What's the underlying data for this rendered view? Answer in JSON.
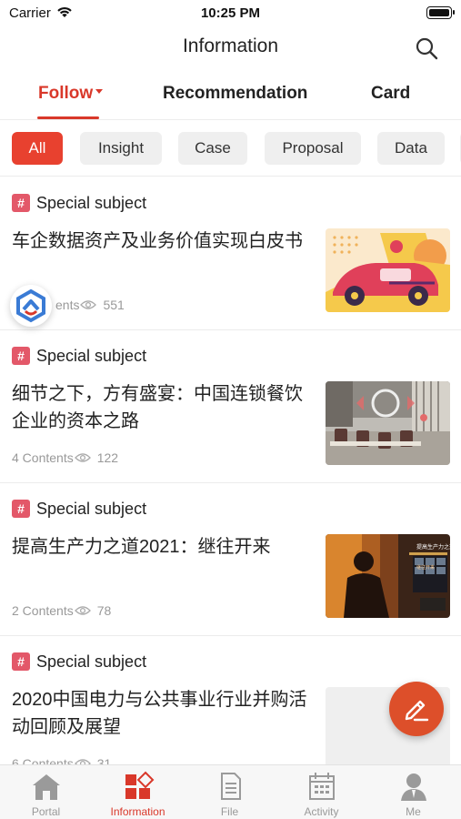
{
  "status_bar": {
    "carrier": "Carrier",
    "time": "10:25 PM"
  },
  "header": {
    "title": "Information"
  },
  "tabs": [
    {
      "label": "Follow",
      "active": true
    },
    {
      "label": "Recommendation",
      "active": false
    },
    {
      "label": "Card",
      "active": false
    }
  ],
  "filters": [
    {
      "label": "All",
      "active": true
    },
    {
      "label": "Insight"
    },
    {
      "label": "Case"
    },
    {
      "label": "Proposal"
    },
    {
      "label": "Data"
    }
  ],
  "feed": [
    {
      "tag_icon": "#",
      "tag": "Special subject",
      "title": "车企数据资产及业务价值实现白皮书",
      "contents": "ents",
      "views": "551"
    },
    {
      "tag_icon": "#",
      "tag": "Special subject",
      "title": "细节之下，方有盛宴：中国连锁餐饮企业的资本之路",
      "contents": "4 Contents",
      "views": "122"
    },
    {
      "tag_icon": "#",
      "tag": "Special subject",
      "title": "提高生产力之道2021：继往开来",
      "contents": "2 Contents",
      "views": "78",
      "thumb_text_1": "提高生产力之道 2021",
      "thumb_text_2": "继往开来"
    },
    {
      "tag_icon": "#",
      "tag": "Special subject",
      "title": "2020中国电力与公共事业行业并购活动回顾及展望",
      "contents": "6 Contents",
      "views": "31"
    }
  ],
  "tabbar": [
    {
      "label": "Portal",
      "icon": "house-icon"
    },
    {
      "label": "Information",
      "icon": "blocks-icon",
      "active": true
    },
    {
      "label": "File",
      "icon": "document-icon"
    },
    {
      "label": "Activity",
      "icon": "calendar-icon"
    },
    {
      "label": "Me",
      "icon": "person-icon"
    }
  ],
  "colors": {
    "accent": "#d9382a",
    "fab": "#dd4f2a",
    "chip_active": "#e8412f",
    "tag_icon": "#e35869"
  }
}
